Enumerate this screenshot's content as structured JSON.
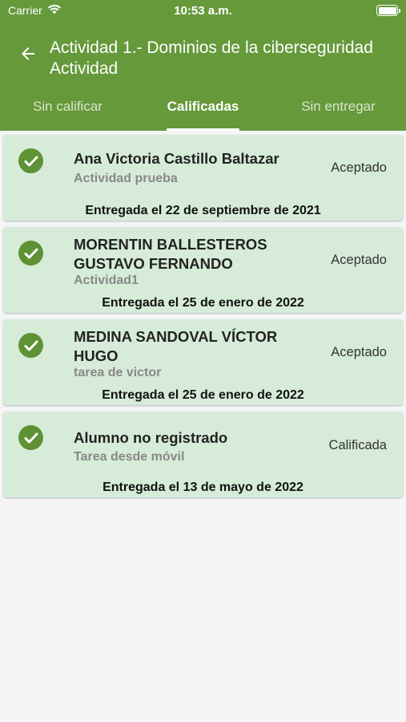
{
  "status_bar": {
    "carrier": "Carrier",
    "time": "10:53 a.m."
  },
  "header": {
    "title": "Actividad 1.- Dominios de la ciberseguridad Actividad"
  },
  "tabs": [
    {
      "label": "Sin calificar",
      "active": false
    },
    {
      "label": "Calificadas",
      "active": true
    },
    {
      "label": "Sin entregar",
      "active": false
    }
  ],
  "submissions": [
    {
      "name": "Ana Victoria Castillo Baltazar",
      "task": "Actividad prueba",
      "status": "Aceptado",
      "date": "Entregada el 22 de septiembre de 2021"
    },
    {
      "name": "MORENTIN BALLESTEROS GUSTAVO FERNANDO",
      "task": "Actividad1",
      "status": "Aceptado",
      "date": "Entregada el 25 de enero de 2022"
    },
    {
      "name": "MEDINA SANDOVAL VÍCTOR HUGO",
      "task": "tarea de victor",
      "status": "Aceptado",
      "date": "Entregada el 25 de enero de 2022"
    },
    {
      "name": "Alumno no registrado",
      "task": "Tarea desde móvil",
      "status": "Calificada",
      "date": "Entregada el 13 de mayo de 2022"
    }
  ],
  "colors": {
    "appbar": "#66993a",
    "card": "#d6ecd9",
    "check": "#5f9135"
  }
}
